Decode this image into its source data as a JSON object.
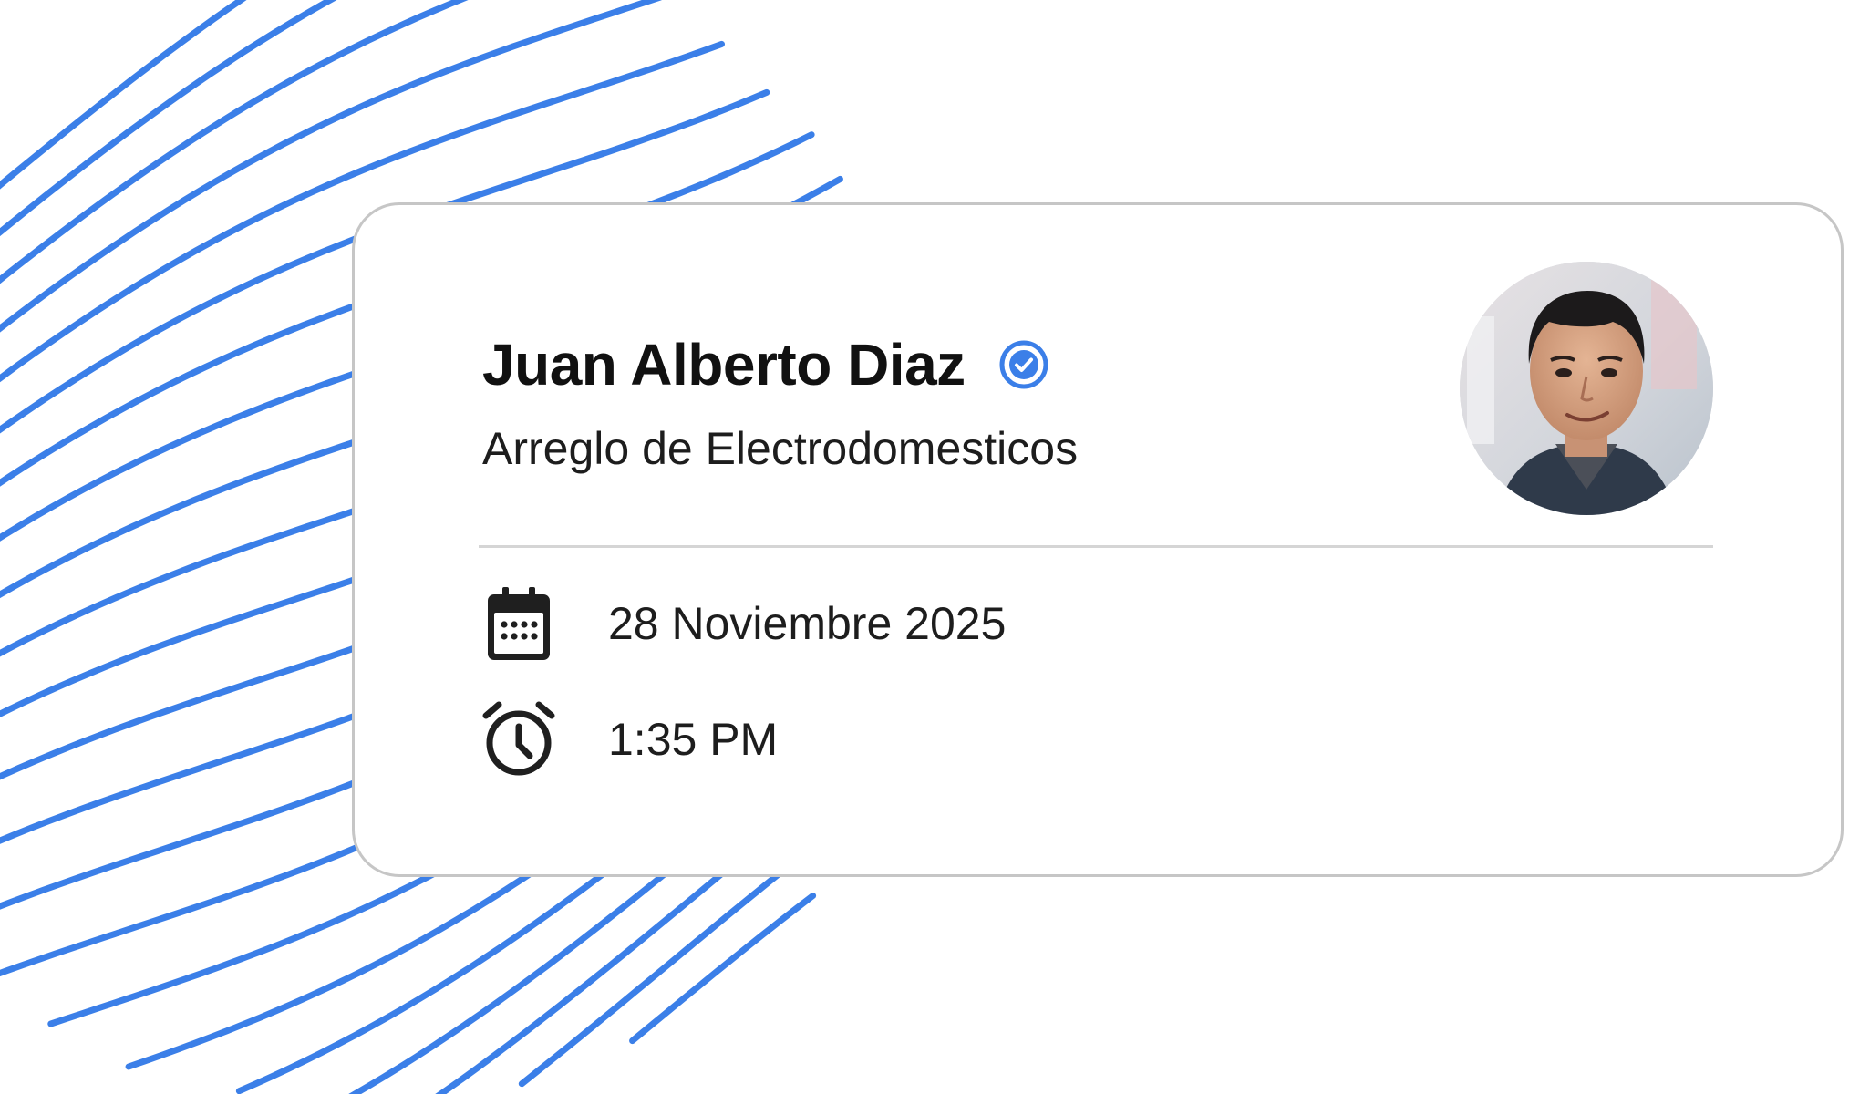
{
  "card": {
    "name": "Juan Alberto Diaz",
    "service": "Arreglo de Electrodomesticos",
    "date": "28 Noviembre 2025",
    "time": "1:35 PM"
  },
  "icons": {
    "verified": "verified-check-icon",
    "date": "calendar-icon",
    "time": "alarm-clock-icon"
  },
  "colors": {
    "accent": "#3b7fe8",
    "text": "#111111",
    "card_border": "#c6c6c6",
    "divider": "#d5d5d5"
  }
}
